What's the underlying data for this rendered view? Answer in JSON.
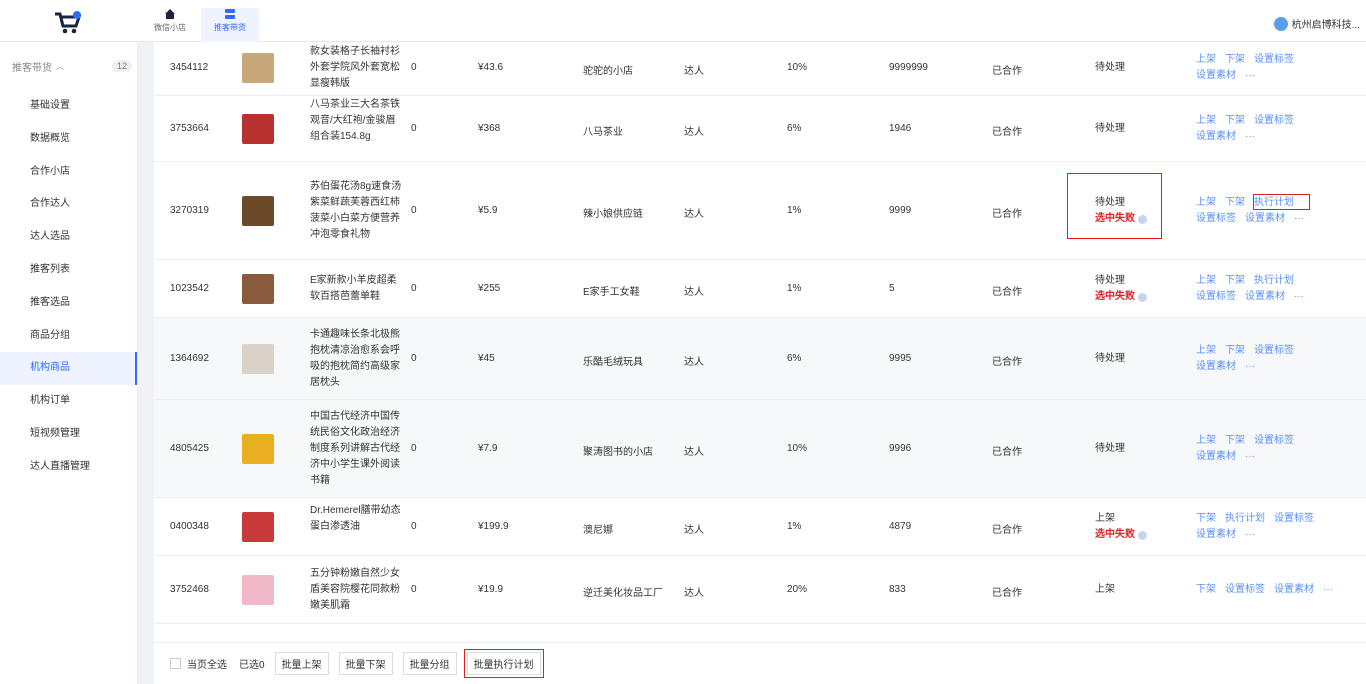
{
  "topbar": {
    "tabs": [
      {
        "label": "微信小店",
        "icon": "home-icon"
      },
      {
        "label": "推客带货",
        "icon": "layers-icon"
      }
    ],
    "user": "杭州启博科技..."
  },
  "sidebar": {
    "section": {
      "label": "推客带货",
      "count": "12"
    },
    "items": [
      {
        "label": "基础设置"
      },
      {
        "label": "数据概览"
      },
      {
        "label": "合作小店"
      },
      {
        "label": "合作达人"
      },
      {
        "label": "达人选品"
      },
      {
        "label": "推客列表"
      },
      {
        "label": "推客选品"
      },
      {
        "label": "商品分组"
      },
      {
        "label": "机构商品",
        "active": true
      },
      {
        "label": "机构订单"
      },
      {
        "label": "短视频管理"
      },
      {
        "label": "达人直播管理"
      }
    ]
  },
  "rows": [
    {
      "id": "3454112",
      "name": "款女装格子长袖衬衫外套学院风外套宽松显瘦韩版",
      "n0": "0",
      "price": "¥43.6",
      "shop": "驼驼的小店",
      "type": "达人",
      "rate": "10%",
      "stock": "9999999",
      "coop": "已合作",
      "status": "待处理",
      "fail": "",
      "ops1": [
        "上架",
        "下架",
        "设置标签"
      ],
      "ops2": [
        "设置素材",
        "···"
      ],
      "color": "#c8a87a"
    },
    {
      "id": "3753664",
      "name": "八马茶业三大名茶铁观音/大红袍/金骏眉组合装154.8g",
      "n0": "0",
      "price": "¥368",
      "shop": "八马茶业",
      "type": "达人",
      "rate": "6%",
      "stock": "1946",
      "coop": "已合作",
      "status": "待处理",
      "fail": "",
      "ops1": [
        "上架",
        "下架",
        "设置标签"
      ],
      "ops2": [
        "设置素材",
        "···"
      ],
      "color": "#b8312f"
    },
    {
      "id": "3270319",
      "name": "苏伯蛋花汤8g速食汤紫菜鲜蔬芙蓉西红柿菠菜小白菜方便营养冲泡零食礼物",
      "n0": "0",
      "price": "¥5.9",
      "shop": "辣小娘供应链",
      "type": "达人",
      "rate": "1%",
      "stock": "9999",
      "coop": "已合作",
      "status": "待处理",
      "fail": "选中失败",
      "ops1": [
        "上架",
        "下架",
        "执行计划"
      ],
      "ops2": [
        "设置标签",
        "设置素材",
        "···"
      ],
      "color": "#6b4a2a"
    },
    {
      "id": "1023542",
      "name": "E家新款小羊皮超柔软百搭芭蕾单鞋",
      "n0": "0",
      "price": "¥255",
      "shop": "E家手工女鞋",
      "type": "达人",
      "rate": "1%",
      "stock": "5",
      "coop": "已合作",
      "status": "待处理",
      "fail": "选中失败",
      "ops1": [
        "上架",
        "下架",
        "执行计划"
      ],
      "ops2": [
        "设置标签",
        "设置素材",
        "···"
      ],
      "color": "#8a5a3c"
    },
    {
      "id": "1364692",
      "name": "卡通趣味长条北极熊抱枕清凉治愈系会呼吸的抱枕简约高级家居枕头",
      "n0": "0",
      "price": "¥45",
      "shop": "乐酷毛绒玩具",
      "type": "达人",
      "rate": "6%",
      "stock": "9995",
      "coop": "已合作",
      "status": "待处理",
      "fail": "",
      "ops1": [
        "上架",
        "下架",
        "设置标签"
      ],
      "ops2": [
        "设置素材",
        "···"
      ],
      "color": "#d8d2c8"
    },
    {
      "id": "4805425",
      "name": "中国古代经济中国传统民俗文化政治经济制度系列讲解古代经济中小学生课外阅读书籍",
      "n0": "0",
      "price": "¥7.9",
      "shop": "聚涛图书的小店",
      "type": "达人",
      "rate": "10%",
      "stock": "9996",
      "coop": "已合作",
      "status": "待处理",
      "fail": "",
      "ops1": [
        "上架",
        "下架",
        "设置标签"
      ],
      "ops2": [
        "设置素材",
        "···"
      ],
      "color": "#e8b020"
    },
    {
      "id": "0400348",
      "name": "Dr.Hemerel膳带幼态蛋白渗透油",
      "n0": "0",
      "price": "¥199.9",
      "shop": "澳尼娜",
      "type": "达人",
      "rate": "1%",
      "stock": "4879",
      "coop": "已合作",
      "status": "上架",
      "fail": "选中失败",
      "ops1": [
        "下架",
        "执行计划",
        "设置标签"
      ],
      "ops2": [
        "设置素材",
        "···"
      ],
      "color": "#c83a3a"
    },
    {
      "id": "3752468",
      "name": "五分钟粉嫩自然少女盾美容院樱花同款粉嫩美肌霜",
      "n0": "0",
      "price": "¥19.9",
      "shop": "逆迁美化妆品工厂",
      "type": "达人",
      "rate": "20%",
      "stock": "833",
      "coop": "已合作",
      "status": "上架",
      "fail": "",
      "ops1": [
        "下架",
        "设置标签",
        "设置素材",
        "···"
      ],
      "ops2": [],
      "color": "#f0b8c8"
    }
  ],
  "footer": {
    "select_all": "当页全选",
    "selected": "已选0",
    "buttons": [
      "批量上架",
      "批量下架",
      "批量分组",
      "批量执行计划"
    ]
  }
}
